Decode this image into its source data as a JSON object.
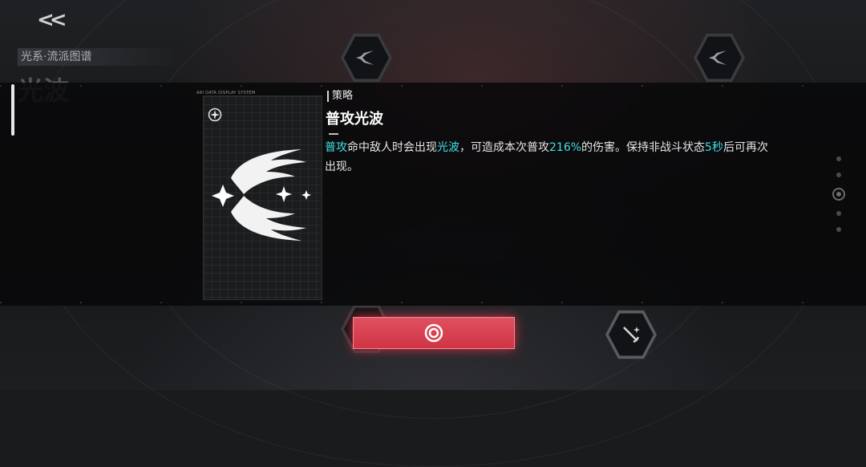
{
  "nav": {
    "back_label": "<<"
  },
  "header": {
    "breadcrumb": "光系·流派图谱",
    "title": "光波"
  },
  "card": {
    "caption": "ARI DATA DISPLAY SYSTEM",
    "emblem_icon": "light-wave-emblem-icon",
    "badge_icon": "compass-star-icon"
  },
  "detail": {
    "section_label": "策略",
    "skill_name": "普攻光波",
    "description": {
      "t1": "普攻",
      "t2": "命中敌人时会出现",
      "t3": "光波",
      "t4": "，可造成本次普攻",
      "t5": "216%",
      "t6": "的伤害。保持非战斗状态",
      "t7": "5秒",
      "t8": "后可再次出现。"
    }
  },
  "confirm_button": {
    "icon": "target-ring-icon"
  },
  "colors": {
    "highlight": "#3ee0e6",
    "confirm": "#d63a4b",
    "background": "#1a1b1d"
  }
}
